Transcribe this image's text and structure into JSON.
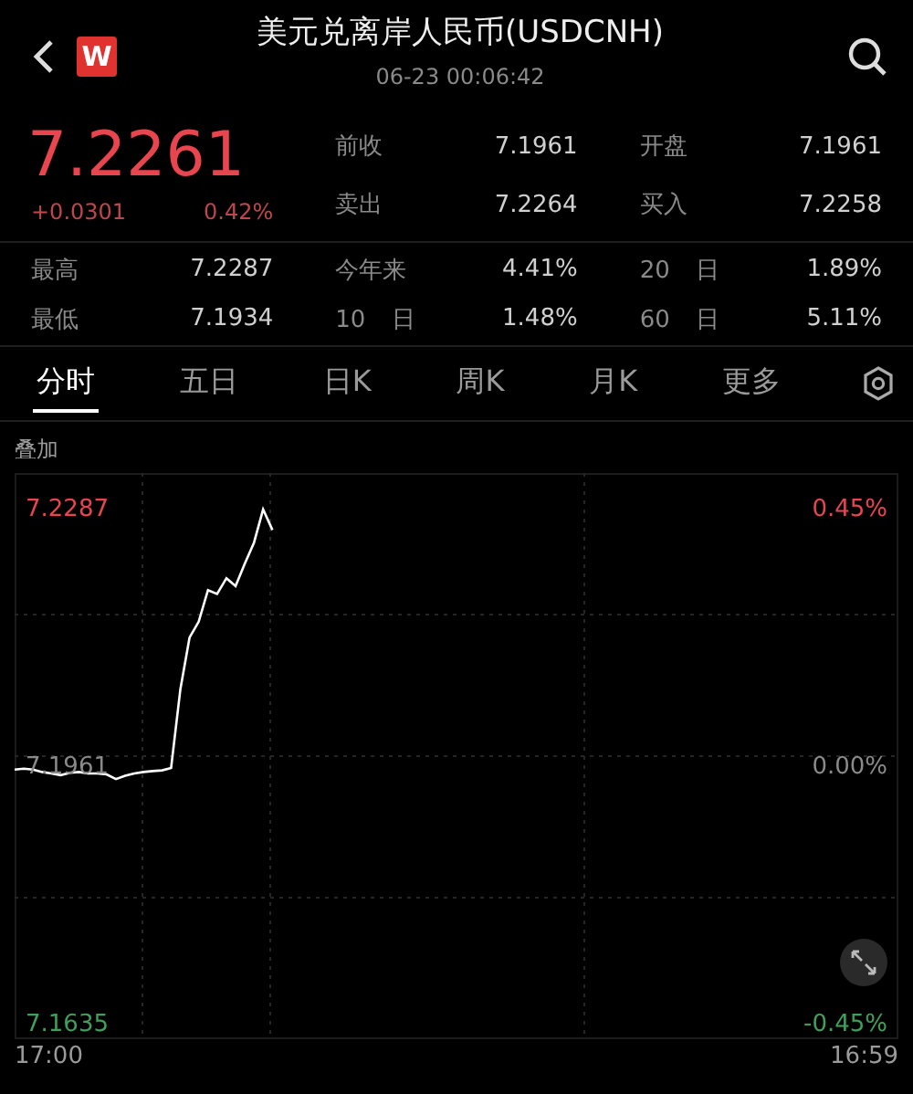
{
  "header": {
    "logo": "W",
    "title": "美元兑离岸人民币(USDCNH)",
    "timestamp": "06-23 00:06:42"
  },
  "quote": {
    "price": "7.2261",
    "change": "+0.0301",
    "change_pct": "0.42%"
  },
  "quote_fields": [
    {
      "label": "前收",
      "value": "7.1961"
    },
    {
      "label": "开盘",
      "value": "7.1961"
    },
    {
      "label": "卖出",
      "value": "7.2264"
    },
    {
      "label": "买入",
      "value": "7.2258"
    }
  ],
  "stats": [
    {
      "label": "最高",
      "value": "7.2287"
    },
    {
      "label": "今年来",
      "value": "4.41%"
    },
    {
      "label": "20 日",
      "value": "1.89%"
    },
    {
      "label": "最低",
      "value": "7.1934"
    },
    {
      "label": "10 日",
      "value": "1.48%"
    },
    {
      "label": "60 日",
      "value": "5.11%"
    }
  ],
  "tabs": [
    {
      "label": "分时",
      "selected": true
    },
    {
      "label": "五日",
      "selected": false
    },
    {
      "label": "日K",
      "selected": false
    },
    {
      "label": "周K",
      "selected": false
    },
    {
      "label": "月K",
      "selected": false
    },
    {
      "label": "更多",
      "selected": false
    }
  ],
  "overlay_label": "叠加",
  "chart": {
    "percent_labels": [
      {
        "text": "0.45%",
        "color": "#e8454f"
      },
      {
        "text": "0.00%",
        "color": "#8a8a8a"
      },
      {
        "text": "-0.45%",
        "color": "#3fa05a"
      }
    ],
    "x_axis_labels": [
      "17:00",
      "16:59"
    ],
    "chart_data": {
      "type": "line",
      "ylim": [
        7.1617,
        7.2333
      ],
      "yticks": [
        {
          "value": 7.2287,
          "label": "7.2287"
        },
        {
          "value": 7.1961,
          "label": "7.1961"
        },
        {
          "value": 7.1635,
          "label": "7.1635"
        }
      ],
      "categories": [
        null,
        null,
        null,
        null,
        null,
        null,
        null,
        null,
        null,
        null,
        null,
        null,
        null,
        null,
        null,
        null,
        null,
        null,
        null,
        null,
        null,
        null,
        null,
        null,
        null,
        null,
        null,
        null,
        null,
        null,
        null,
        null,
        null,
        null,
        null,
        null,
        null,
        null,
        null,
        null,
        null,
        null,
        null,
        null,
        null,
        null,
        null,
        null,
        null,
        null,
        null,
        null,
        null,
        null,
        null,
        null,
        null,
        null,
        null,
        null,
        null,
        null,
        null,
        null,
        null,
        null,
        null,
        null,
        null,
        null,
        null,
        null,
        null,
        null,
        null,
        null,
        null,
        null,
        null,
        null,
        null,
        null,
        null,
        null,
        null,
        null,
        null,
        null,
        null,
        null,
        null,
        null,
        null,
        null,
        null,
        null,
        null
      ],
      "series": [
        {
          "color": "#ffffff",
          "values": [
            7.1958,
            7.1959,
            7.1958,
            7.1955,
            7.1953,
            7.1951,
            7.1954,
            7.1955,
            7.1953,
            7.1953,
            7.1952,
            7.1946,
            7.195,
            7.1953,
            7.1955,
            7.1956,
            7.1957,
            7.196,
            7.206,
            7.2125,
            7.2145,
            7.2185,
            7.218,
            7.22,
            7.219,
            7.2218,
            7.2245,
            7.2287,
            7.2261,
            null,
            null,
            null,
            null,
            null,
            null,
            null,
            null,
            null,
            null,
            null,
            null,
            null,
            null,
            null,
            null,
            null,
            null,
            null,
            null,
            null,
            null,
            null,
            null,
            null,
            null,
            null,
            null,
            null,
            null,
            null,
            null,
            null,
            null,
            null,
            null,
            null,
            null,
            null,
            null,
            null,
            null,
            null,
            null,
            null,
            null,
            null,
            null,
            null,
            null,
            null,
            null,
            null,
            null,
            null,
            null,
            null,
            null,
            null,
            null,
            null,
            null,
            null,
            null,
            null,
            null,
            null,
            null
          ]
        }
      ]
    }
  }
}
